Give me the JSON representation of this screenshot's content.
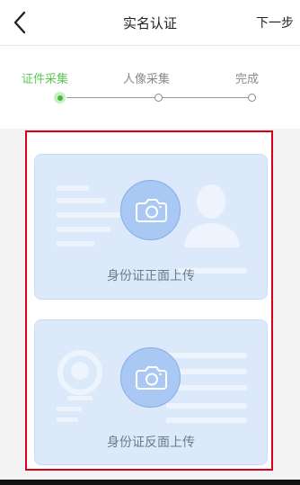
{
  "nav": {
    "title": "实名认证",
    "next_label": "下一步",
    "back_icon": "chevron-left-icon"
  },
  "steps": [
    {
      "label": "证件采集",
      "state": "active"
    },
    {
      "label": "人像采集",
      "state": "pending"
    },
    {
      "label": "完成",
      "state": "pending"
    }
  ],
  "upload": {
    "front": {
      "label": "身份证正面上传",
      "icon": "camera-icon"
    },
    "back": {
      "label": "身份证反面上传",
      "icon": "camera-icon"
    }
  },
  "colors": {
    "accent": "#5cc857",
    "card_bg": "#dce9fb",
    "highlight_border": "#d6001c"
  }
}
